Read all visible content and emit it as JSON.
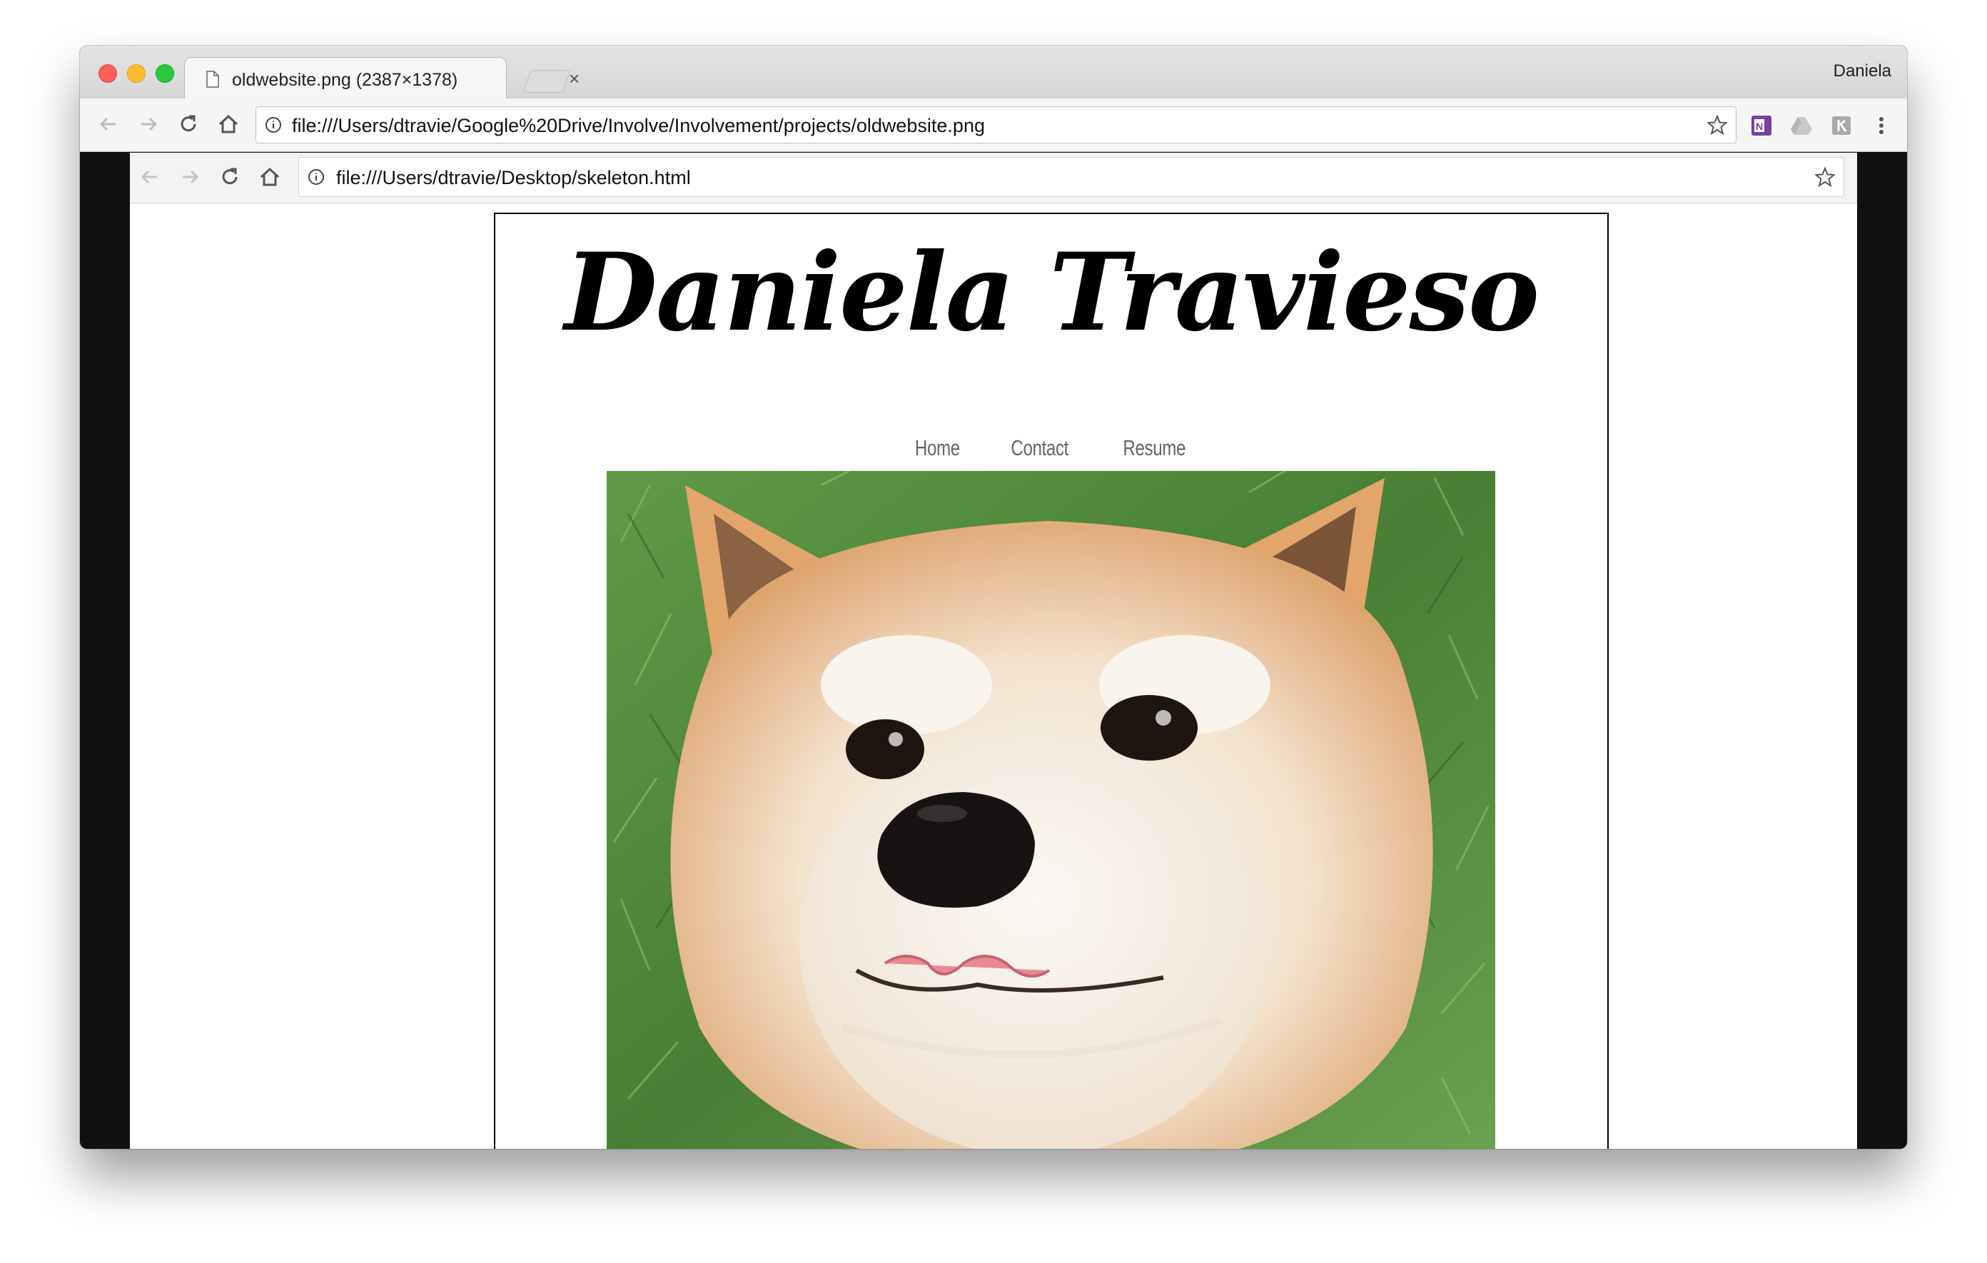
{
  "browser": {
    "tab_title": "oldwebsite.png (2387×1378)",
    "tab_close": "×",
    "profile_name": "Daniela",
    "address_url": "file:///Users/dtravie/Google%20Drive/Involve/Involvement/projects/oldwebsite.png",
    "icons": [
      "back-icon",
      "forward-icon",
      "reload-icon",
      "home-icon",
      "info-icon",
      "star-icon",
      "onenote-icon",
      "drive-icon",
      "extension-icon",
      "menu-icon"
    ]
  },
  "inner_browser": {
    "address_url": "file:///Users/dtravie/Desktop/skeleton.html"
  },
  "site": {
    "title": "Daniela Travieso",
    "nav": [
      "Home",
      "Contact",
      "Resume"
    ]
  },
  "colors": {
    "window_frame": "#111111",
    "nav_text": "#666666",
    "grass": "#4f8a3a",
    "fur_orange": "#e0a060",
    "fur_cream": "#f6efe6"
  }
}
